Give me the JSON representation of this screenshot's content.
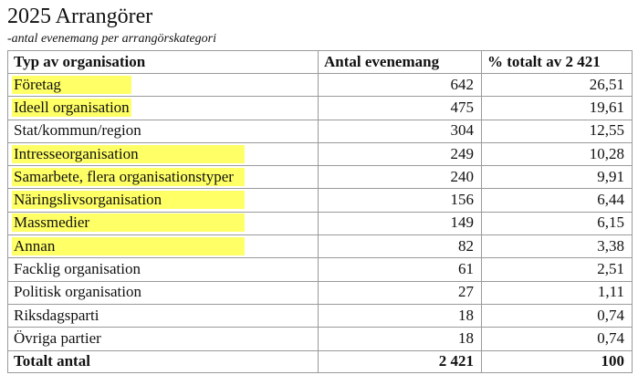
{
  "document": {
    "title": "2025 Arrangörer",
    "subtitle": "-antal evenemang per arrangörskategori"
  },
  "table": {
    "headers": [
      "Typ av organisation",
      "Antal evenemang",
      "% totalt av 2 421"
    ],
    "rows": [
      {
        "type": "Företag",
        "count": "642",
        "percent": "26,51",
        "highlighted": true
      },
      {
        "type": "Ideell organisation",
        "count": "475",
        "percent": "19,61",
        "highlighted": true
      },
      {
        "type": "Stat/kommun/region",
        "count": "304",
        "percent": "12,55",
        "highlighted": false
      },
      {
        "type": "Intresseorganisation",
        "count": "249",
        "percent": "10,28",
        "highlighted": true
      },
      {
        "type": "Samarbete, flera organisationstyper",
        "count": "240",
        "percent": "9,91",
        "highlighted": true
      },
      {
        "type": "Näringslivsorganisation",
        "count": "156",
        "percent": "6,44",
        "highlighted": true
      },
      {
        "type": "Massmedier",
        "count": "149",
        "percent": "6,15",
        "highlighted": true
      },
      {
        "type": "Annan",
        "count": "82",
        "percent": "3,38",
        "highlighted": true
      },
      {
        "type": "Facklig organisation",
        "count": "61",
        "percent": "2,51",
        "highlighted": false
      },
      {
        "type": "Politisk organisation",
        "count": "27",
        "percent": "1,11",
        "highlighted": false
      },
      {
        "type": "Riksdagsparti",
        "count": "18",
        "percent": "0,74",
        "highlighted": false
      },
      {
        "type": "Övriga partier",
        "count": "18",
        "percent": "0,74",
        "highlighted": false
      }
    ],
    "total": {
      "label": "Totalt antal",
      "count": "2 421",
      "percent": "100"
    }
  },
  "colors": {
    "highlight": "#ffff66",
    "border": "#9a9a9a",
    "text": "#111111"
  }
}
